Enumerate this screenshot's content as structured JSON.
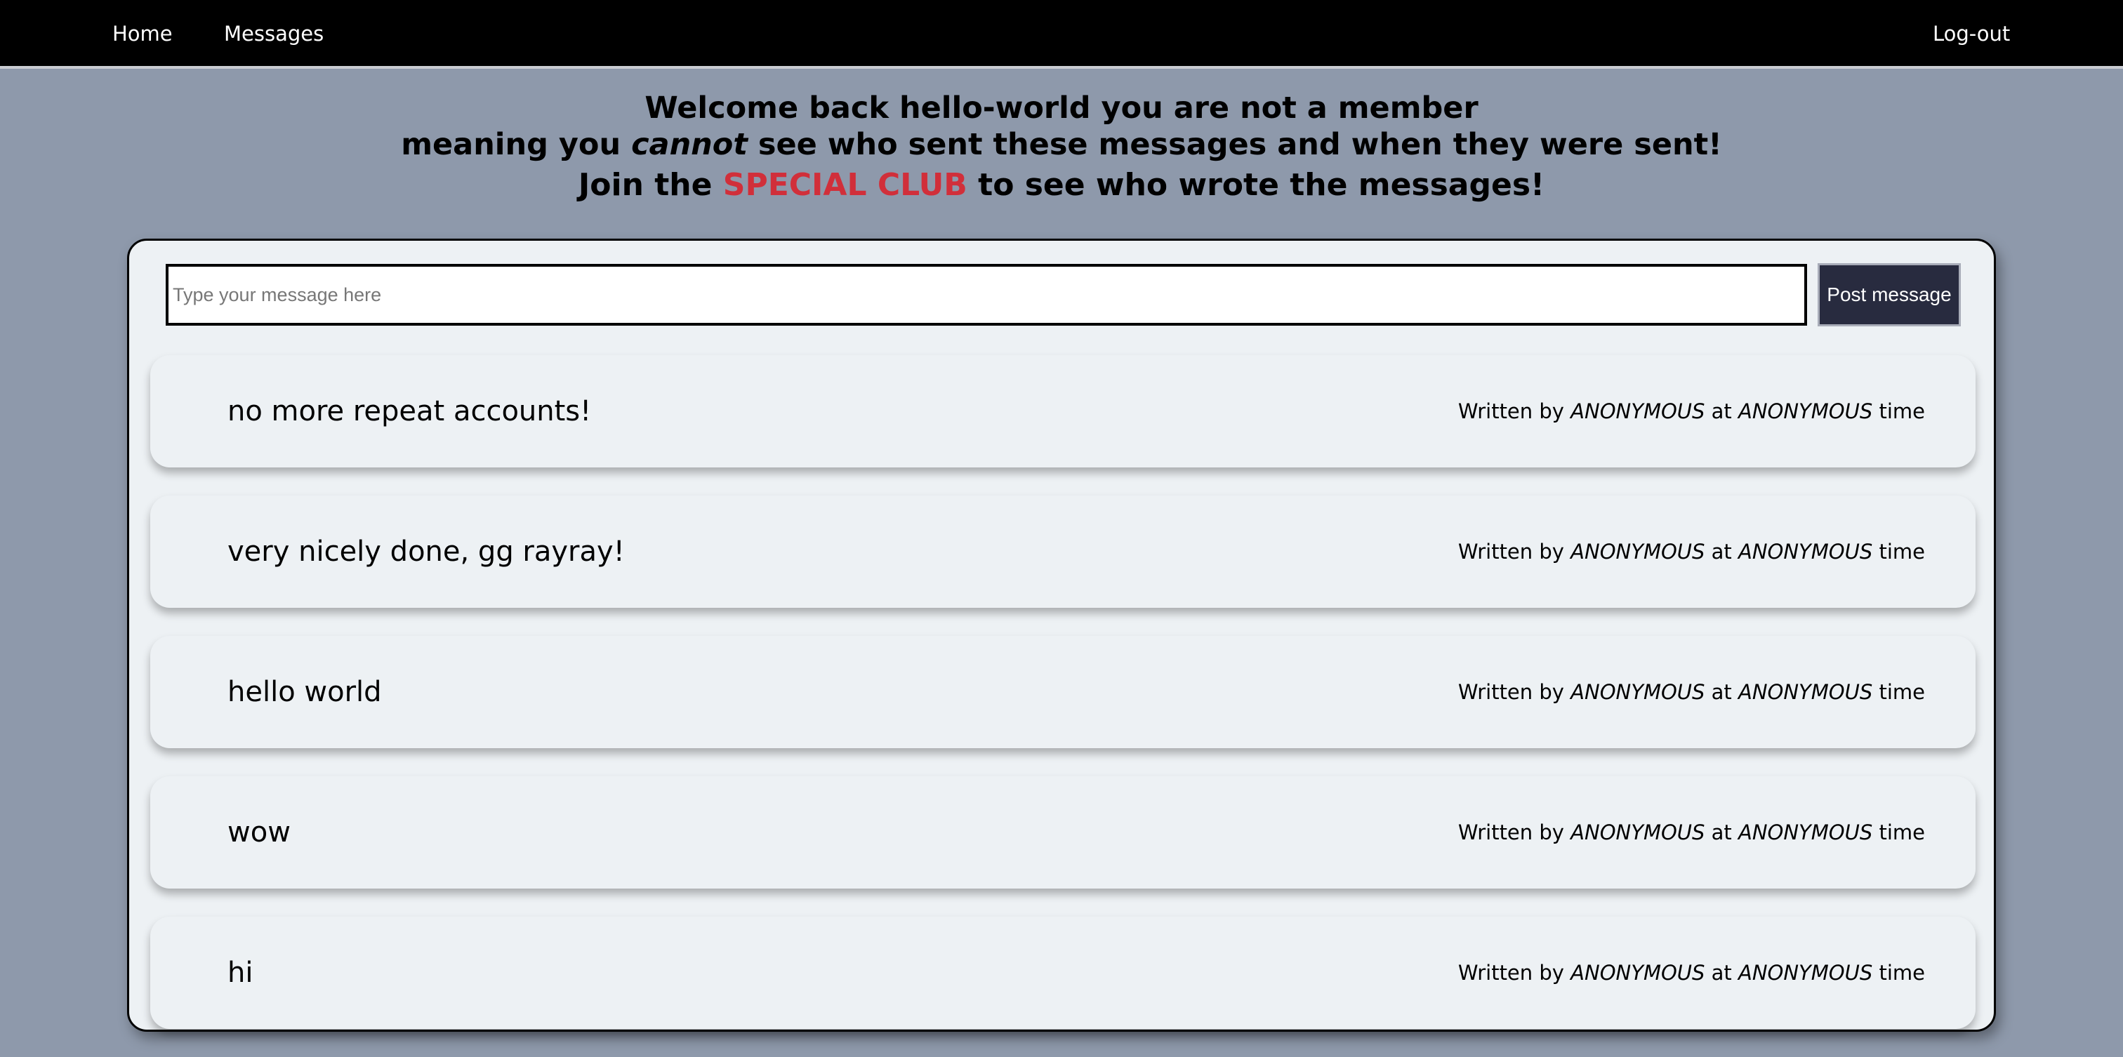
{
  "nav": {
    "home": "Home",
    "messages": "Messages",
    "logout": "Log-out"
  },
  "header": {
    "welcome": "Welcome back hello-world you are not a member",
    "line2_prefix": "meaning you ",
    "line2_emph": "cannot",
    "line2_suffix": " see who sent these messages and when they were sent!",
    "line3_prefix": "Join the ",
    "line3_special": "SPECIAL CLUB",
    "line3_suffix": " to see who wrote the messages!"
  },
  "composer": {
    "placeholder": "Type your message here",
    "post_label": "Post message"
  },
  "meta_labels": {
    "written_by": "Written by ",
    "author": "ANONYMOUS",
    "at": " at ",
    "time_value": "ANONYMOUS",
    "time_suffix": " time"
  },
  "messages": [
    {
      "text": "no more repeat accounts!"
    },
    {
      "text": "very nicely done, gg rayray!"
    },
    {
      "text": "hello world"
    },
    {
      "text": "wow"
    },
    {
      "text": "hi"
    }
  ],
  "colors": {
    "background": "#8e99ab",
    "navbar": "#000000",
    "accent_special": "#d12f3a",
    "button": "#282b3f",
    "card": "#edf1f4"
  }
}
